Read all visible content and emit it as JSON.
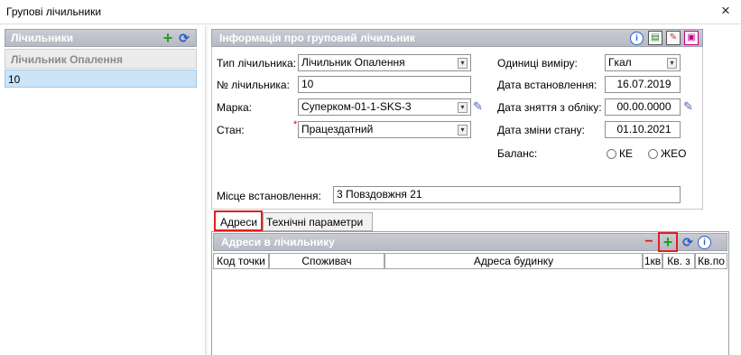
{
  "window": {
    "title": "Групові лічильники",
    "close": "×"
  },
  "left": {
    "panel_title": "Лічильники",
    "column_header": "Лічильник Опалення",
    "rows": [
      "10"
    ]
  },
  "info": {
    "panel_title": "Інформація про груповий лічильник",
    "type_label": "Тип лічильника:",
    "type_value": "Лічильник Опалення",
    "number_label": "№ лічильника:",
    "number_value": "10",
    "brand_label": "Марка:",
    "brand_value": "Суперком-01-1-SKS-3",
    "state_label": "Стан:",
    "state_value": "Працездатний",
    "units_label": "Одиниці виміру:",
    "units_value": "Гкал",
    "install_date_label": "Дата встановлення:",
    "install_date_value": "16.07.2019",
    "removal_date_label": "Дата зняття з обліку:",
    "removal_date_value": "00.00.0000",
    "state_change_label": "Дата зміни стану:",
    "state_change_value": "01.10.2021",
    "balance_label": "Баланс:",
    "balance_options": [
      "КЕ",
      "ЖЕО"
    ],
    "location_label": "Місце встановлення:",
    "location_value": "3 Повздовжня 21"
  },
  "tabs": [
    "Адреси",
    "Технічні параметри"
  ],
  "addresses": {
    "panel_title": "Адреси в лічильнику",
    "columns": [
      "Код точки",
      "Споживач",
      "Адреса будинку",
      "1кв",
      "Кв. з",
      "Кв.по"
    ]
  },
  "colors": {
    "accent_header": "#b9bdc7",
    "selection": "#cce4f7",
    "highlight": "#e02020"
  }
}
